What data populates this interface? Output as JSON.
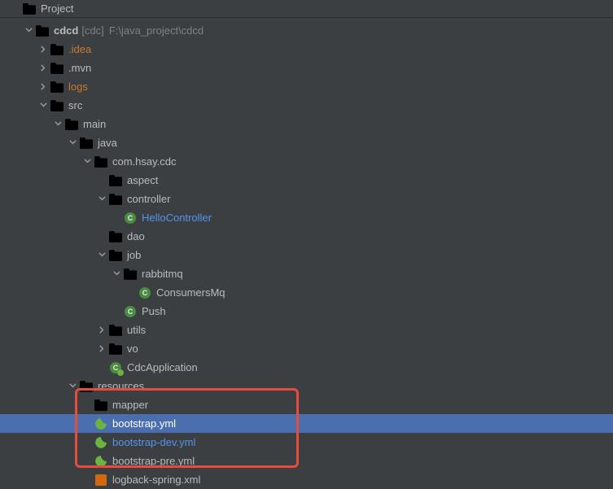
{
  "sidebar": {
    "project_tab": "Project"
  },
  "header": {
    "title": "Project"
  },
  "root": {
    "name": "cdcd",
    "module": "[cdc]",
    "path": "F:\\java_project\\cdcd"
  },
  "tree": {
    "idea": ".idea",
    "mvn": ".mvn",
    "logs": "logs",
    "src": "src",
    "main": "main",
    "java": "java",
    "pkg": "com.hsay.cdc",
    "aspect": "aspect",
    "controller": "controller",
    "hello": "HelloController",
    "dao": "dao",
    "job": "job",
    "rabbitmq": "rabbitmq",
    "consumers": "ConsumersMq",
    "push": "Push",
    "utils": "utils",
    "vo": "vo",
    "cdcapp": "CdcApplication",
    "resources": "resources",
    "mapper": "mapper",
    "bootstrap": "bootstrap.yml",
    "bootstrap_dev": "bootstrap-dev.yml",
    "bootstrap_pre": "bootstrap-pre.yml",
    "logback": "logback-spring.xml"
  }
}
